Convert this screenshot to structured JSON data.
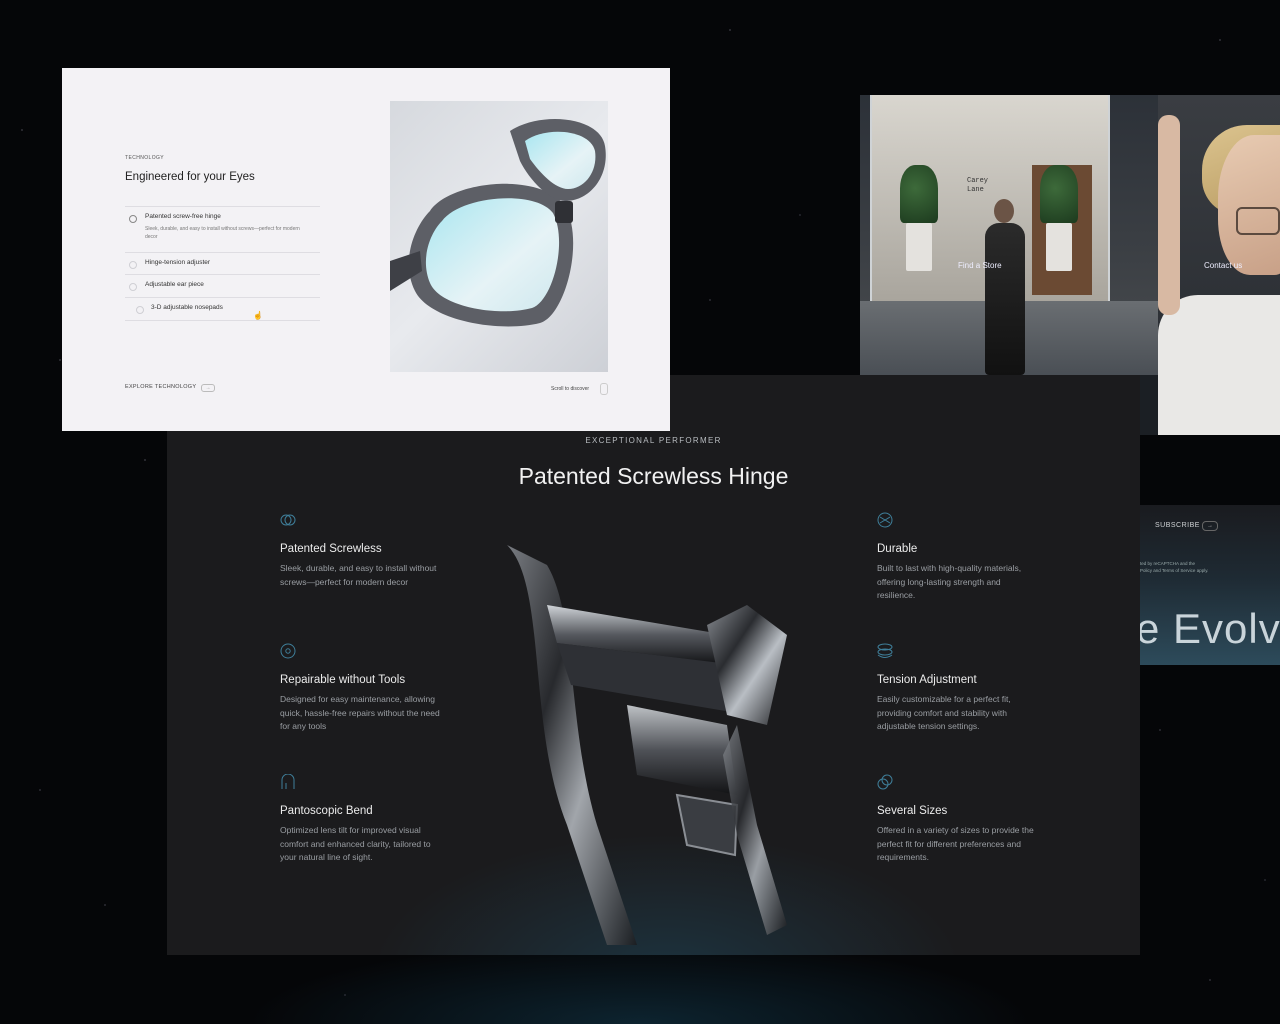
{
  "white_panel": {
    "eyebrow": "TECHNOLOGY",
    "title": "Engineered for your Eyes",
    "accordion": [
      {
        "label": "Patented screw-free hinge",
        "desc": "Sleek, durable, and easy to install without screws—perfect for modern decor"
      },
      {
        "label": "Hinge-tension adjuster"
      },
      {
        "label": "Adjustable ear piece"
      },
      {
        "label": "3-D adjustable nosepads"
      }
    ],
    "explore": "EXPLORE TECHNOLOGY",
    "explore_arrow": "→",
    "scroll": "Scroll to discover"
  },
  "right_panel": {
    "store_sign": "Carey\nLane",
    "find_store": "Find a Store",
    "contact": "Contact us",
    "subscribe": "SUBSCRIBE",
    "subscribe_arrow": "→",
    "recaptcha_line1": "ted by reCAPTCHA and the",
    "recaptcha_line2": "Policy and Terms of Service apply.",
    "evolve": "e Evolv"
  },
  "dark_panel": {
    "eyebrow": "EXCEPTIONAL PERFORMER",
    "title": "Patented Screwless Hinge",
    "features_left": [
      {
        "icon": "screwless-icon",
        "title": "Patented Screwless",
        "desc": "Sleek, durable, and easy to install without screws—perfect for modern decor"
      },
      {
        "icon": "tools-icon",
        "title": "Repairable without Tools",
        "desc": "Designed for easy maintenance, allowing quick, hassle-free repairs without the need for any tools"
      },
      {
        "icon": "bend-icon",
        "title": "Pantoscopic Bend",
        "desc": "Optimized lens tilt for improved visual comfort and enhanced clarity, tailored to your natural line of sight."
      }
    ],
    "features_right": [
      {
        "icon": "durable-icon",
        "title": "Durable",
        "desc": "Built to last with high-quality materials, offering long-lasting strength and resilience."
      },
      {
        "icon": "tension-icon",
        "title": "Tension Adjustment",
        "desc": "Easily customizable for a perfect fit, providing comfort and stability with adjustable tension settings."
      },
      {
        "icon": "sizes-icon",
        "title": "Several Sizes",
        "desc": "Offered in a variety of sizes to provide the perfect fit for different preferences and requirements."
      }
    ]
  },
  "colors": {
    "accent_icon": "#3f7f9a",
    "dark_bg": "#1b1b1d",
    "white_bg": "#f3f2f5"
  }
}
